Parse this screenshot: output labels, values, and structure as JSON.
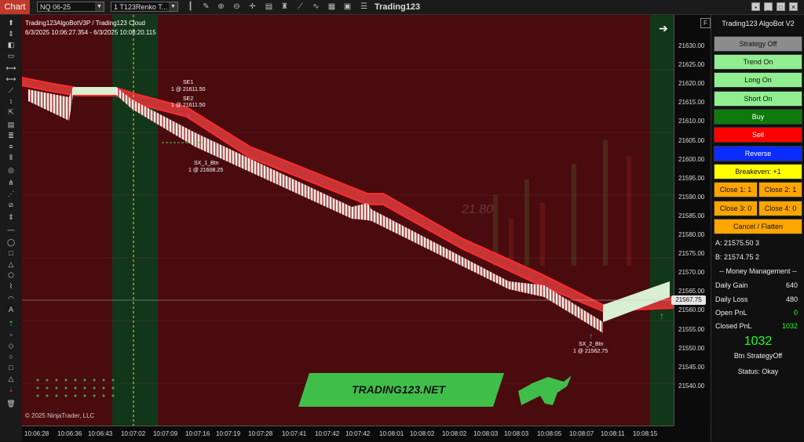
{
  "toolbar": {
    "chart_tab": "Chart",
    "instrument": "NQ 06-25",
    "bartype": "1 T123Renko T...",
    "title": "Trading123"
  },
  "chart": {
    "strategy_line": "Trading123AlgoBotV3P / Trading123 Cloud",
    "date_range": "6/3/2025 10:06:27.354 - 6/3/2025 10:08:20.115",
    "copyright": "© 2025 NinjaTrader, LLC",
    "last_price": "21567.75",
    "watermark": "21.80",
    "banner": "TRADING123.NET",
    "price_ticks": [
      "21630.00",
      "21625.00",
      "21620.00",
      "21615.00",
      "21610.00",
      "21605.00",
      "21600.00",
      "21595.00",
      "21590.00",
      "21585.00",
      "21580.00",
      "21575.00",
      "21570.00",
      "21565.00",
      "21560.00",
      "21555.00",
      "21550.00",
      "21545.00",
      "21540.00"
    ],
    "time_ticks": [
      "10:06:28",
      "10:06:36",
      "10:06:43",
      "10:07:02",
      "10:07:09",
      "10:07:16",
      "10:07:19",
      "10:07:28",
      "10:07:41",
      "10:07:42",
      "10:07:42",
      "10:08:01",
      "10:08:02",
      "10:08:02",
      "10:08:03",
      "10:08:03",
      "10:08:05",
      "10:08:07",
      "10:08:11",
      "10:08:15"
    ],
    "markers": {
      "se1_label": "SE1",
      "se1_fill": "1 @ 21611.50",
      "se2_label": "SE2",
      "se2_fill": "1 @ 21611.50",
      "sx1_label": "SX_1_Btn",
      "sx1_fill": "1 @ 21608.25",
      "sx2_label": "SX_2_Btn",
      "sx2_fill": "1 @ 21562.75"
    }
  },
  "panel": {
    "title": "Trading123 AlgoBot V2",
    "strategy_off": "Strategy Off",
    "trend_on": "Trend On",
    "long_on": "Long On",
    "short_on": "Short On",
    "buy": "Buy",
    "sell": "Sell",
    "reverse": "Reverse",
    "breakeven": "Breakeven:  +1",
    "close1": "Close 1:  1",
    "close2": "Close 2:  1",
    "close3": "Close 3:  0",
    "close4": "Close 4:  0",
    "cancel_flatten": "Cancel / Flatten",
    "ask": "A: 21575.50   3",
    "bid": "B: 21574.75   2",
    "money_mgmt": "-- Money Management --",
    "daily_gain_label": "Daily Gain",
    "daily_gain": "640",
    "daily_loss_label": "Daily Loss",
    "daily_loss": "480",
    "open_pnl_label": "Open PnL",
    "open_pnl": "0",
    "closed_pnl_label": "Closed PnL",
    "closed_pnl": "1032",
    "big_pnl": "1032",
    "btn_status": "Btn StrategyOff",
    "status": "Status: Okay"
  }
}
